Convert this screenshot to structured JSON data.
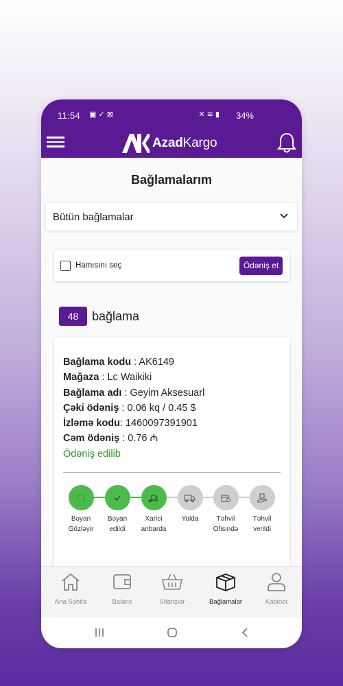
{
  "status_bar": {
    "time": "11:54",
    "battery": "34%"
  },
  "app": {
    "logo_brand": "Azad",
    "logo_suffix": "Kargo"
  },
  "page": {
    "title": "Bağlamalarım"
  },
  "filter": {
    "selected": "Bütün bağlamalar"
  },
  "selection": {
    "select_all_label": "Hamısını seç",
    "pay_button": "Ödəniş et"
  },
  "count": {
    "number": "48",
    "label": "bağlama"
  },
  "package": {
    "code_label": "Bağlama kodu",
    "code": " : AK6149",
    "store_label": "Mağaza",
    "store": " : Lc Waikiki",
    "name_label": "Bağlama adı",
    "name": " : Geyim Aksesuarl",
    "weight_label": "Çəki ödəniş",
    "weight": " : 0.06 kq / 0.45 $",
    "tracking_label": "İzləmə kodu",
    "tracking": ": 1460097391901",
    "total_label": "Cəm ödəniş",
    "total": " : 0.76 ₼",
    "payment_status": "Ödəniş edilib",
    "steps": [
      {
        "line1": "Bəyan",
        "line2": "Gözləyir",
        "done": true,
        "icon": "hourglass-icon"
      },
      {
        "line1": "Bəyan",
        "line2": "edildi",
        "done": true,
        "icon": "check-icon"
      },
      {
        "line1": "Xarici",
        "line2": "anbarda",
        "done": true,
        "icon": "warehouse-icon"
      },
      {
        "line1": "Yolda",
        "line2": "",
        "done": false,
        "icon": "truck-icon"
      },
      {
        "line1": "Təhvil",
        "line2": "Ofisində",
        "done": false,
        "icon": "box-icon"
      },
      {
        "line1": "Təhvil",
        "line2": "verildi",
        "done": false,
        "icon": "hand-box-icon"
      }
    ]
  },
  "bottom_nav": [
    {
      "label": "Ana Səhifə",
      "icon": "home-icon"
    },
    {
      "label": "Balans",
      "icon": "wallet-icon"
    },
    {
      "label": "Sifarişlər",
      "icon": "basket-icon"
    },
    {
      "label": "Bağlamalar",
      "icon": "package-icon",
      "active": true
    },
    {
      "label": "Kabinet",
      "icon": "user-icon"
    }
  ],
  "colors": {
    "brand": "#5a1a94",
    "success": "#4cbb4c",
    "paid_text": "#2b9a2b",
    "pending": "#cfcfcf"
  }
}
